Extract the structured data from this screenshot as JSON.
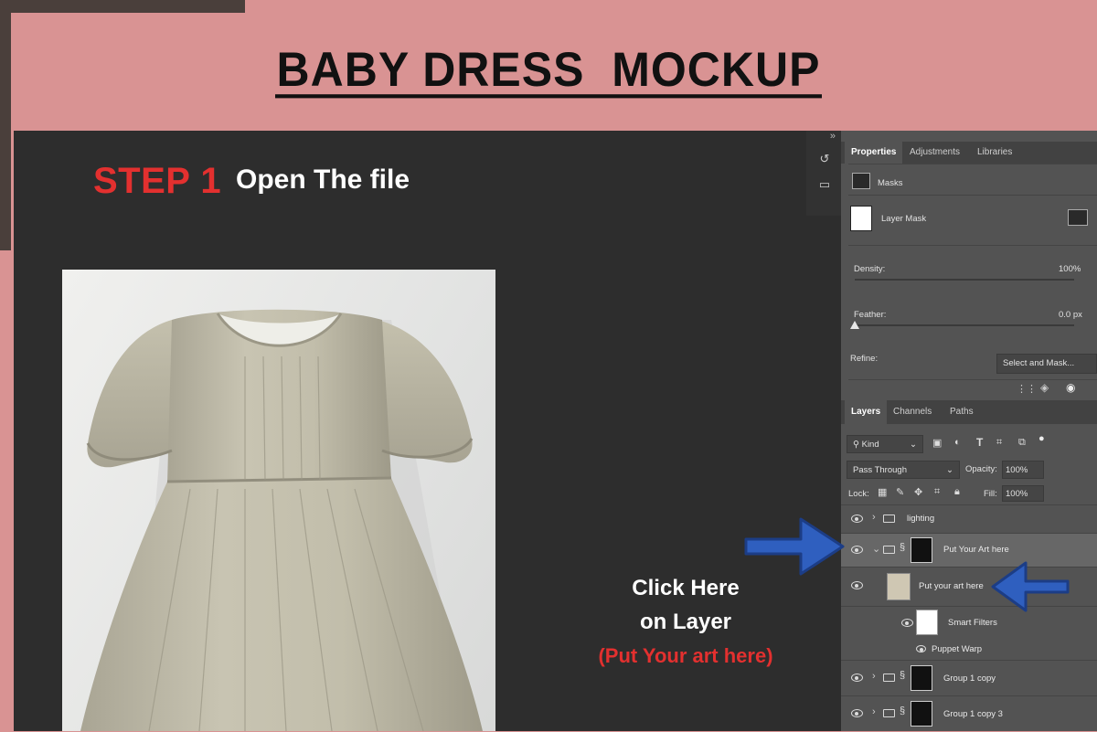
{
  "header": {
    "title": "BABY DRESS  MOCKUP"
  },
  "step": {
    "label": "STEP 1",
    "text": "Open The file"
  },
  "callout": {
    "line1": "Click Here",
    "line2": "on Layer",
    "line3": "(Put Your art here)"
  },
  "colors": {
    "background": "#d99393",
    "panel": "#2d2d2d",
    "accent_red": "#e3302f",
    "arrow_blue": "#2f5fbf"
  },
  "properties_panel": {
    "collapse_icon": "double-chevron-icon",
    "tabs": [
      "Properties",
      "Adjustments",
      "Libraries"
    ],
    "masks_label": "Masks",
    "layer_mask_label": "Layer Mask",
    "density_label": "Density:",
    "density_value": "100%",
    "feather_label": "Feather:",
    "feather_value": "0.0 px",
    "refine_label": "Refine:",
    "select_mask_button": "Select and Mask..."
  },
  "layers_panel": {
    "tabs": [
      "Layers",
      "Channels",
      "Paths"
    ],
    "filter_kind": "Kind",
    "blend_mode": "Pass Through",
    "opacity_label": "Opacity:",
    "opacity_value": "100%",
    "lock_label": "Lock:",
    "fill_label": "Fill:",
    "fill_value": "100%",
    "layers": [
      {
        "name": "lighting",
        "type": "group"
      },
      {
        "name": "Put Your Art here",
        "type": "group",
        "selected": true
      },
      {
        "name": "Put your art here",
        "type": "smart-object"
      },
      {
        "name": "Smart Filters",
        "type": "filter"
      },
      {
        "name": "Puppet Warp",
        "type": "filter-item"
      },
      {
        "name": "Group 1 copy",
        "type": "group"
      },
      {
        "name": "Group 1 copy 3",
        "type": "group"
      }
    ]
  }
}
